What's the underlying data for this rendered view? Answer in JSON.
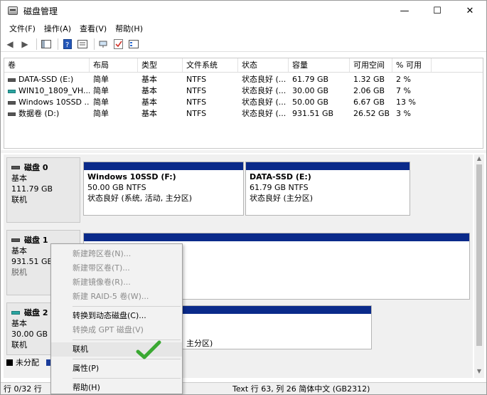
{
  "window": {
    "title": "磁盘管理",
    "min": "—",
    "max": "☐",
    "close": "✕"
  },
  "menu": [
    "文件(F)",
    "操作(A)",
    "查看(V)",
    "帮助(H)"
  ],
  "volume_table": {
    "headers": [
      "卷",
      "布局",
      "类型",
      "文件系统",
      "状态",
      "容量",
      "可用空间",
      "% 可用"
    ],
    "rows": [
      {
        "icon": "gray",
        "vol": "DATA-SSD (E:)",
        "layout": "简单",
        "type": "基本",
        "fs": "NTFS",
        "status": "状态良好 (...",
        "capacity": "61.79 GB",
        "free": "1.32 GB",
        "pct": "2 %"
      },
      {
        "icon": "teal",
        "vol": "WIN10_1809_VH...",
        "layout": "简单",
        "type": "基本",
        "fs": "NTFS",
        "status": "状态良好 (...",
        "capacity": "30.00 GB",
        "free": "2.06 GB",
        "pct": "7 %"
      },
      {
        "icon": "gray",
        "vol": "Windows 10SSD ...",
        "layout": "简单",
        "type": "基本",
        "fs": "NTFS",
        "status": "状态良好 (...",
        "capacity": "50.00 GB",
        "free": "6.67 GB",
        "pct": "13 %"
      },
      {
        "icon": "gray",
        "vol": "数据卷 (D:)",
        "layout": "简单",
        "type": "基本",
        "fs": "NTFS",
        "status": "状态良好 (...",
        "capacity": "931.51 GB",
        "free": "26.52 GB",
        "pct": "3 %"
      }
    ]
  },
  "disks": [
    {
      "name": "磁盘 0",
      "type": "基本",
      "size": "111.79 GB",
      "state": "联机",
      "partitions": [
        {
          "name": "Windows 10SSD  (F:)",
          "size": "50.00 GB NTFS",
          "status": "状态良好 (系统, 活动, 主分区)"
        },
        {
          "name": "DATA-SSD  (E:)",
          "size": "61.79 GB NTFS",
          "status": "状态良好 (主分区)"
        }
      ]
    },
    {
      "name": "磁盘 1",
      "type": "基本",
      "size": "931.51 GB",
      "state": "脱机"
    },
    {
      "name": "磁盘 2",
      "type": "基本",
      "size": "30.00 GB",
      "state": "联机",
      "partial_status": "主分区)"
    }
  ],
  "legend": {
    "unallocated": "未分配"
  },
  "statusbar": {
    "left": "行 0/32 行",
    "right": "Text  行 63, 列 26  简体中文 (GB2312)"
  },
  "context_menu": {
    "items": [
      {
        "label": "新建跨区卷(N)...",
        "enabled": false
      },
      {
        "label": "新建带区卷(T)...",
        "enabled": false
      },
      {
        "label": "新建镜像卷(R)...",
        "enabled": false
      },
      {
        "label": "新建 RAID-5 卷(W)...",
        "enabled": false
      },
      {
        "label": "转换到动态磁盘(C)...",
        "enabled": true
      },
      {
        "label": "转换成 GPT 磁盘(V)",
        "enabled": false
      },
      {
        "label": "联机",
        "enabled": true,
        "highlighted": true
      },
      {
        "label": "属性(P)",
        "enabled": true
      },
      {
        "label": "帮助(H)",
        "enabled": true
      }
    ]
  },
  "colors": {
    "partition_bar": "#0a2a8a",
    "check": "#3aa832"
  }
}
